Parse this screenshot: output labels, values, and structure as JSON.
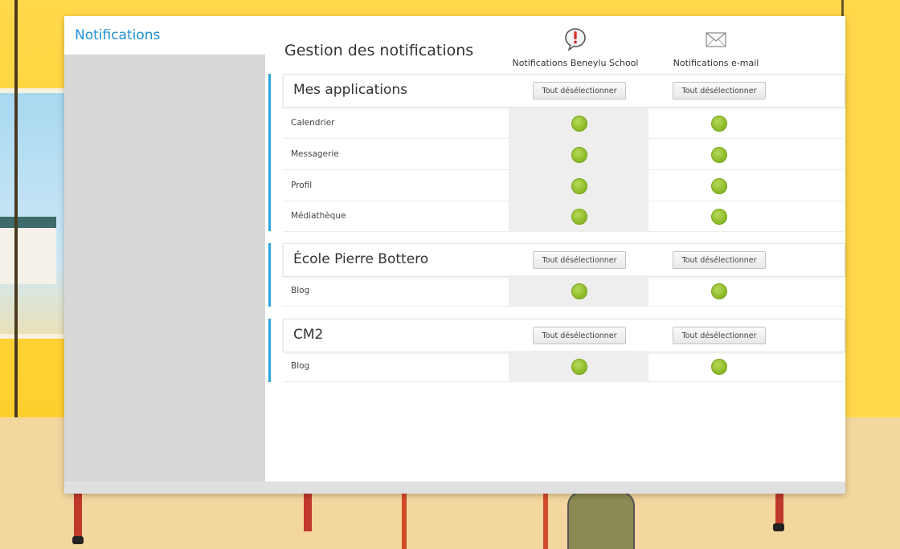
{
  "sidebar": {
    "title": "Notifications"
  },
  "page_title": "Gestion des notifications",
  "columns": {
    "beneylu": {
      "label": "Notifications Beneylu School",
      "icon": "exclamation-bubble-icon"
    },
    "email": {
      "label": "Notifications e-mail",
      "icon": "envelope-icon"
    }
  },
  "colors": {
    "accent": "#2fa6d9",
    "title_blue": "#1f8fd1",
    "dot_green": "#8fbd2a"
  },
  "sections": [
    {
      "title": "Mes applications",
      "btn_beneylu": "Tout désélectionner",
      "btn_email": "Tout désélectionner",
      "rows": [
        {
          "label": "Calendrier",
          "beneylu": true,
          "email": true
        },
        {
          "label": "Messagerie",
          "beneylu": true,
          "email": true
        },
        {
          "label": "Profil",
          "beneylu": true,
          "email": true
        },
        {
          "label": "Médiathèque",
          "beneylu": true,
          "email": true
        }
      ]
    },
    {
      "title": "École Pierre Bottero",
      "btn_beneylu": "Tout désélectionner",
      "btn_email": "Tout désélectionner",
      "rows": [
        {
          "label": "Blog",
          "beneylu": true,
          "email": true
        }
      ]
    },
    {
      "title": "CM2",
      "btn_beneylu": "Tout désélectionner",
      "btn_email": "Tout désélectionner",
      "rows": [
        {
          "label": "Blog",
          "beneylu": true,
          "email": true
        }
      ]
    }
  ]
}
